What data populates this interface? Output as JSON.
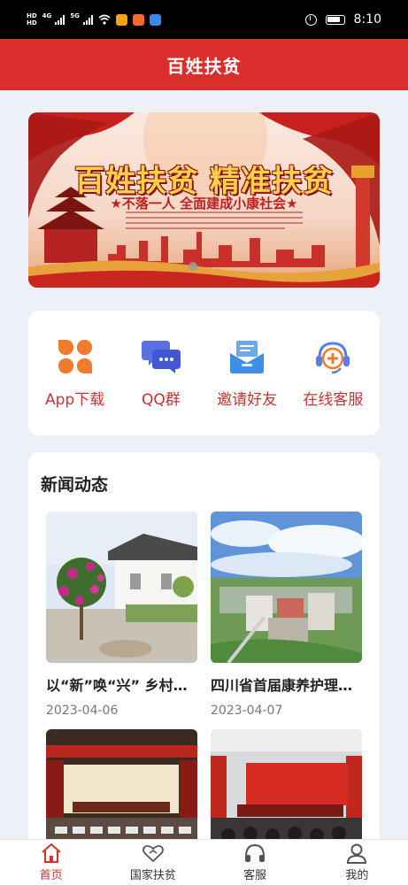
{
  "status_bar": {
    "time": "8:10",
    "hd_1": "HD",
    "hd_2": "HD",
    "net_1": "4G",
    "net_2": "5G"
  },
  "header": {
    "title": "百姓扶贫"
  },
  "banner": {
    "title": "百姓扶贫 精准扶贫",
    "subtitle": "★不落一人 全面建成小康社会★"
  },
  "quick_actions": [
    {
      "label": "App下载",
      "icon": "clover-icon",
      "color": "#f07b2a"
    },
    {
      "label": "QQ群",
      "icon": "chat-bubbles-icon",
      "color": "#5a6fe0"
    },
    {
      "label": "邀请好友",
      "icon": "mail-card-icon",
      "color": "#3f8fe6"
    },
    {
      "label": "在线客服",
      "icon": "headset-icon",
      "color": "#f07b2a"
    }
  ],
  "news": {
    "heading": "新闻动态",
    "items": [
      {
        "title": "以“新”唤“兴” 乡村振兴",
        "date": "2023-04-06"
      },
      {
        "title": "四川省首届康养护理大赛",
        "date": "2023-04-07"
      },
      {
        "title": "",
        "date": ""
      },
      {
        "title": "",
        "date": ""
      }
    ]
  },
  "bottom_nav": [
    {
      "label": "首页",
      "icon": "home-icon",
      "active": true
    },
    {
      "label": "国家扶贫",
      "icon": "heart-icon",
      "active": false
    },
    {
      "label": "客服",
      "icon": "headphones-icon",
      "active": false
    },
    {
      "label": "我的",
      "icon": "user-icon",
      "active": false
    }
  ],
  "colors": {
    "brand_red": "#d92e2c",
    "accent_text": "#c43532",
    "page_bg": "#eef0f7"
  }
}
